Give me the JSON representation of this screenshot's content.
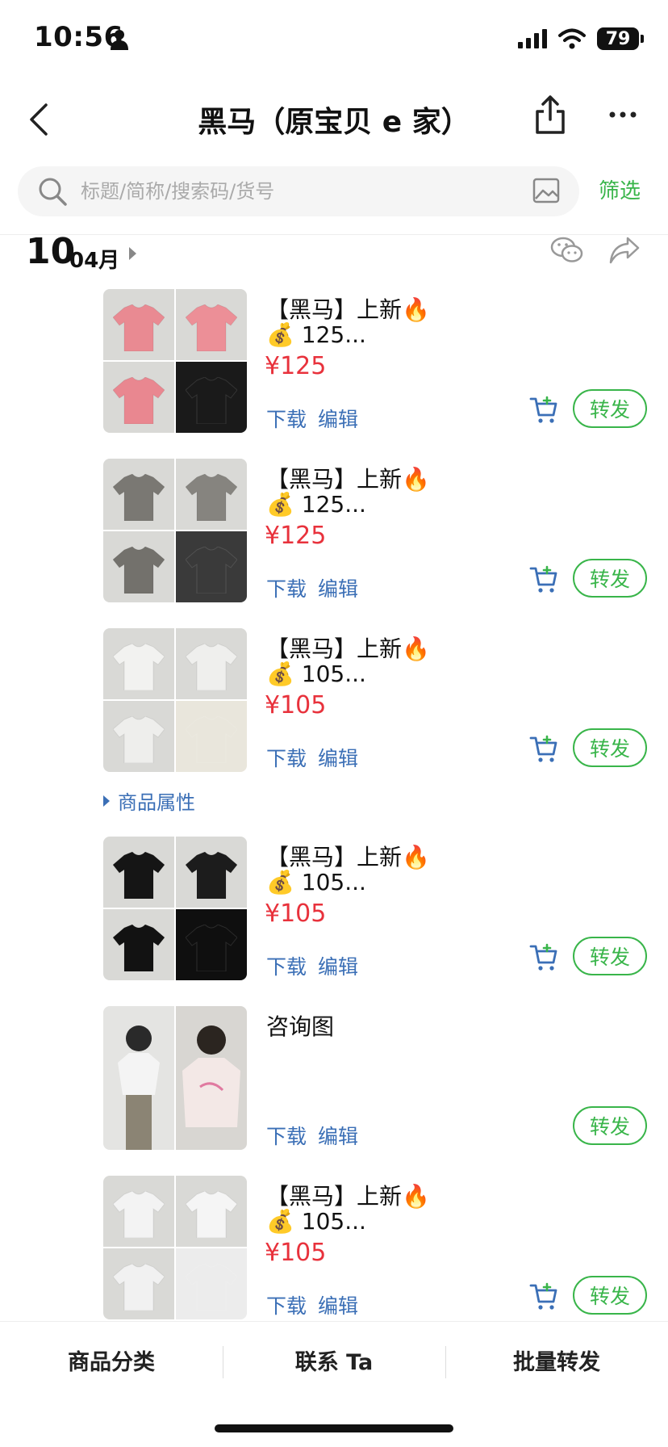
{
  "status_bar": {
    "time": "10:56",
    "battery": "79"
  },
  "nav": {
    "title": "黑马（原宝贝 e 家）"
  },
  "search": {
    "placeholder": "标题/简称/搜索码/货号",
    "filter_label": "筛选"
  },
  "date": {
    "day": "10",
    "month": "04月"
  },
  "items": [
    {
      "title": "【黑马】上新🔥",
      "sub": "💰 125...",
      "price": "¥125",
      "download": "下载",
      "edit": "编辑",
      "forward": "转发",
      "colors": [
        "#e98a92",
        "#ec8f97",
        "#e98790",
        "#1a1a1a"
      ]
    },
    {
      "title": "【黑马】上新🔥",
      "sub": "💰 125...",
      "price": "¥125",
      "download": "下载",
      "edit": "编辑",
      "forward": "转发",
      "colors": [
        "#7a7873",
        "#86847f",
        "#73716c",
        "#3a3a3a"
      ]
    },
    {
      "title": "【黑马】上新🔥",
      "sub": "💰 105...",
      "price": "¥105",
      "download": "下载",
      "edit": "编辑",
      "forward": "转发",
      "colors": [
        "#f2f2f0",
        "#efefed",
        "#eeeeec",
        "#e9e6dc"
      ]
    },
    {
      "title": "【黑马】上新🔥",
      "sub": "💰 105...",
      "price": "¥105",
      "download": "下载",
      "edit": "编辑",
      "forward": "转发",
      "colors": [
        "#151515",
        "#1c1c1c",
        "#121212",
        "#0f0f0f"
      ]
    },
    {
      "title": "咨询图",
      "download": "下载",
      "edit": "编辑",
      "forward": "转发"
    },
    {
      "title": "【黑马】上新🔥",
      "sub": "💰 105...",
      "price": "¥105",
      "download": "下载",
      "edit": "编辑",
      "forward": "转发",
      "colors": [
        "#f3f3f3",
        "#f5f5f5",
        "#f1f1f1",
        "#ececec"
      ]
    }
  ],
  "attributes_label": "商品属性",
  "bottom_bar": {
    "tab1": "商品分类",
    "tab2": "联系 Ta",
    "tab3": "批量转发"
  }
}
